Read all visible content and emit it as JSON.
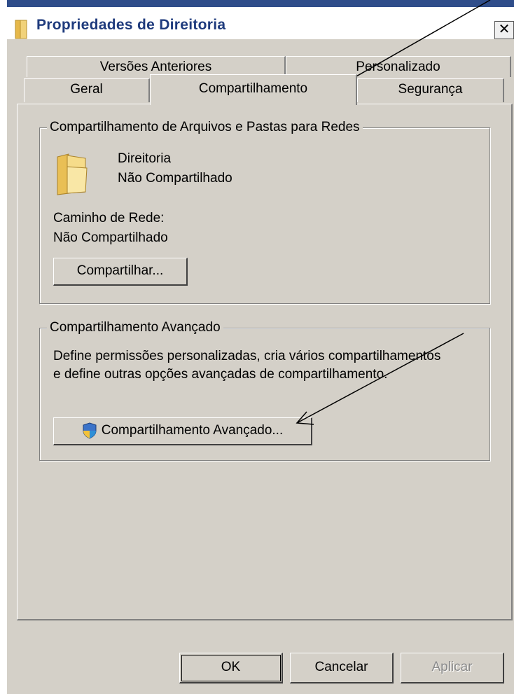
{
  "window": {
    "title": "Propriedades de Direitoria",
    "close_glyph": "✕"
  },
  "tabs": {
    "row1": [
      {
        "label": "Versões Anteriores"
      },
      {
        "label": "Personalizado"
      }
    ],
    "row2": [
      {
        "label": "Geral"
      },
      {
        "label": "Compartilhamento",
        "active": true
      },
      {
        "label": "Segurança"
      }
    ]
  },
  "network_sharing": {
    "group_title": "Compartilhamento de Arquivos e Pastas para Redes",
    "folder_name": "Direitoria",
    "share_status": "Não Compartilhado",
    "network_path_label": "Caminho de Rede:",
    "network_path_value": "Não Compartilhado",
    "share_button": "Compartilhar..."
  },
  "advanced_sharing": {
    "group_title": "Compartilhamento Avançado",
    "description_line1": "Define permissões personalizadas, cria vários compartilhamentos",
    "description_line2": "e define outras opções avançadas de compartilhamento.",
    "button": "Compartilhamento Avançado..."
  },
  "footer": {
    "ok": "OK",
    "cancel": "Cancelar",
    "apply": "Aplicar"
  },
  "colors": {
    "title_text": "#1f3b7d",
    "dialog_bg": "#d4d0c8",
    "annotation_arrow": "#000000"
  }
}
